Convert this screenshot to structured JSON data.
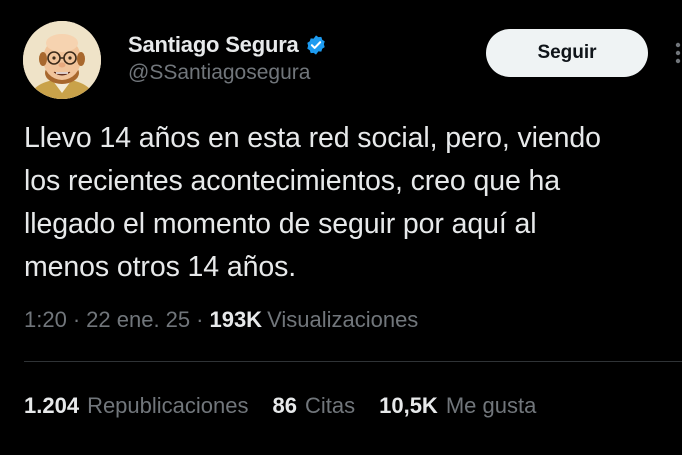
{
  "author": {
    "display_name": "Santiago Segura",
    "handle": "@SSantiagosegura",
    "verified_icon": "verified-badge-icon",
    "verified_color": "#1d9bf0"
  },
  "follow_button": {
    "label": "Seguir"
  },
  "tweet": {
    "lines": [
      "Llevo 14 años en esta red social, pero, viendo",
      "los recientes acontecimientos, creo que ha",
      "llegado el momento de seguir por aquí al",
      "menos otros 14 años."
    ]
  },
  "meta": {
    "time": "1:20",
    "separator": "·",
    "date": "22 ene. 25",
    "views_count": "193K",
    "views_label": "Visualizaciones"
  },
  "stats": {
    "reposts_count": "1.204",
    "reposts_label": "Republicaciones",
    "quotes_count": "86",
    "quotes_label": "Citas",
    "likes_count": "10,5K",
    "likes_label": "Me gusta"
  },
  "colors": {
    "background": "#000000",
    "primary_text": "#e7e9ea",
    "secondary_text": "#71767b",
    "divider": "#2f3336",
    "button_bg": "#eff3f4"
  }
}
